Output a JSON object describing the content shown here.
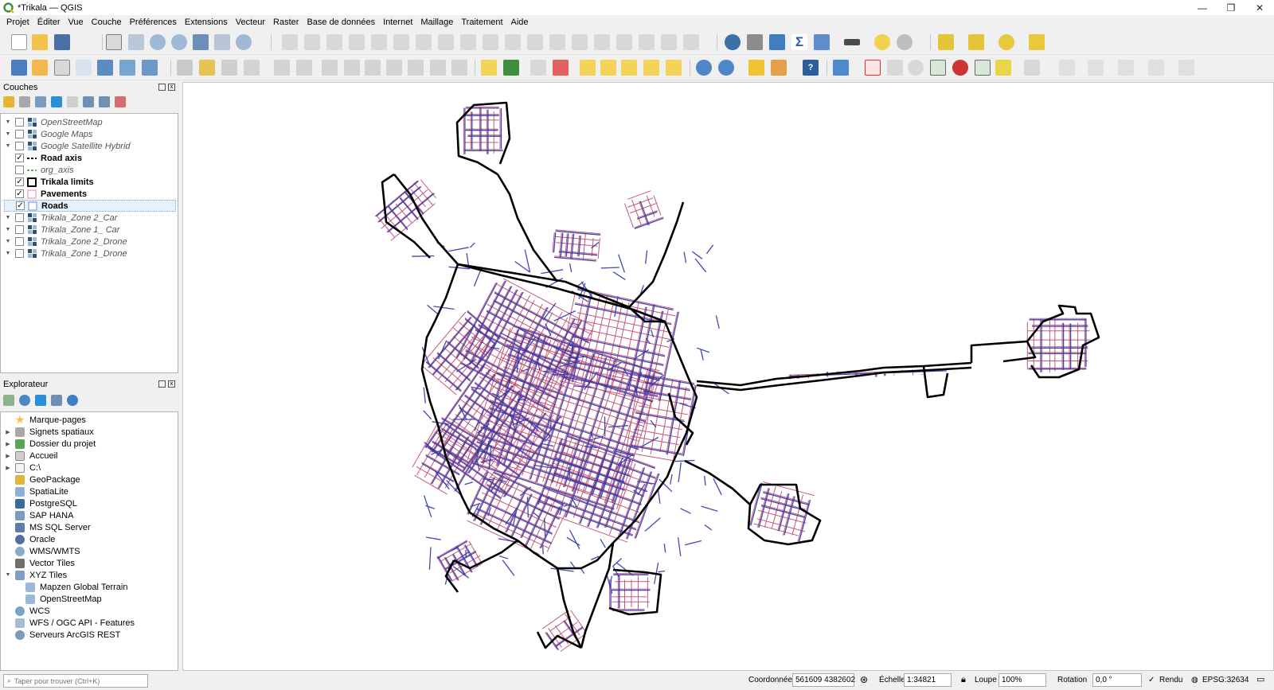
{
  "window": {
    "title": "*Trikala — QGIS",
    "controls": {
      "minimize": "—",
      "restore": "❐",
      "close": "✕"
    }
  },
  "menu": [
    "Projet",
    "Éditer",
    "Vue",
    "Couche",
    "Préférences",
    "Extensions",
    "Vecteur",
    "Raster",
    "Base de données",
    "Internet",
    "Maillage",
    "Traitement",
    "Aide"
  ],
  "layers_panel": {
    "title": "Couches",
    "layers": [
      {
        "name": "OpenStreetMap",
        "checked": false,
        "style": "italic",
        "symbol": "raster-icon"
      },
      {
        "name": "Google Maps",
        "checked": false,
        "style": "italic",
        "symbol": "raster-icon"
      },
      {
        "name": "Google Satellite Hybrid",
        "checked": false,
        "style": "italic",
        "symbol": "raster-icon"
      },
      {
        "name": "Road axis",
        "checked": true,
        "style": "bold",
        "symbol": "dashed-line-icon"
      },
      {
        "name": "org_axis",
        "checked": false,
        "style": "italic",
        "symbol": "dashed-green-line-icon"
      },
      {
        "name": "Trikala limits",
        "checked": true,
        "style": "bold",
        "symbol": "black-polygon-icon"
      },
      {
        "name": "Pavements",
        "checked": true,
        "style": "bold",
        "symbol": "pink-polygon-icon"
      },
      {
        "name": "Roads",
        "checked": true,
        "style": "bold",
        "symbol": "blue-polygon-icon"
      },
      {
        "name": "Trikala_Zone 2_Car",
        "checked": false,
        "style": "italic",
        "symbol": "raster-icon"
      },
      {
        "name": "Trikala_Zone 1_ Car",
        "checked": false,
        "style": "italic",
        "symbol": "raster-icon"
      },
      {
        "name": "Trikala_Zone 2_Drone",
        "checked": false,
        "style": "italic",
        "symbol": "raster-icon"
      },
      {
        "name": "Trikala_Zone 1_Drone",
        "checked": false,
        "style": "italic",
        "symbol": "raster-icon"
      }
    ]
  },
  "browser_panel": {
    "title": "Explorateur",
    "items": [
      {
        "name": "Marque-pages",
        "indent": 0,
        "arrow": "",
        "icon": "star-icon"
      },
      {
        "name": "Signets spatiaux",
        "indent": 0,
        "arrow": "▶",
        "icon": "bookmark-icon"
      },
      {
        "name": "Dossier du projet",
        "indent": 0,
        "arrow": "▶",
        "icon": "project-folder-icon"
      },
      {
        "name": "Accueil",
        "indent": 0,
        "arrow": "▶",
        "icon": "home-icon"
      },
      {
        "name": "C:\\",
        "indent": 0,
        "arrow": "▶",
        "icon": "drive-icon"
      },
      {
        "name": "GeoPackage",
        "indent": 0,
        "arrow": "",
        "icon": "geopackage-icon"
      },
      {
        "name": "SpatiaLite",
        "indent": 0,
        "arrow": "",
        "icon": "spatialite-icon"
      },
      {
        "name": "PostgreSQL",
        "indent": 0,
        "arrow": "",
        "icon": "postgresql-icon"
      },
      {
        "name": "SAP HANA",
        "indent": 0,
        "arrow": "",
        "icon": "sap-hana-icon"
      },
      {
        "name": "MS SQL Server",
        "indent": 0,
        "arrow": "",
        "icon": "mssql-icon"
      },
      {
        "name": "Oracle",
        "indent": 0,
        "arrow": "",
        "icon": "oracle-icon"
      },
      {
        "name": "WMS/WMTS",
        "indent": 0,
        "arrow": "",
        "icon": "wms-icon"
      },
      {
        "name": "Vector Tiles",
        "indent": 0,
        "arrow": "",
        "icon": "vector-tiles-icon"
      },
      {
        "name": "XYZ Tiles",
        "indent": 0,
        "arrow": "▼",
        "icon": "xyz-tiles-icon"
      },
      {
        "name": "Mapzen Global Terrain",
        "indent": 1,
        "arrow": "",
        "icon": "xyz-tile-icon"
      },
      {
        "name": "OpenStreetMap",
        "indent": 1,
        "arrow": "",
        "icon": "xyz-tile-icon"
      },
      {
        "name": "WCS",
        "indent": 0,
        "arrow": "",
        "icon": "wcs-icon"
      },
      {
        "name": "WFS / OGC API - Features",
        "indent": 0,
        "arrow": "",
        "icon": "wfs-icon"
      },
      {
        "name": "Serveurs ArcGIS REST",
        "indent": 0,
        "arrow": "",
        "icon": "arcgis-icon"
      }
    ]
  },
  "status": {
    "search_placeholder": "Taper pour trouver (Ctrl+K)",
    "coord_label": "Coordonnée",
    "coord_value": "561609  4382602",
    "scale_label": "Échelle",
    "scale_value": "1:34821",
    "magnifier_label": "Loupe",
    "magnifier_value": "100%",
    "rotation_label": "Rotation",
    "rotation_value": "0,0 °",
    "render_label": "Rendu",
    "crs": "EPSG:32634"
  },
  "colors": {
    "road_axis": "#000000",
    "roads": "#1f2aa8",
    "pavements": "#b5305a",
    "accent": "#3c8f3c"
  }
}
